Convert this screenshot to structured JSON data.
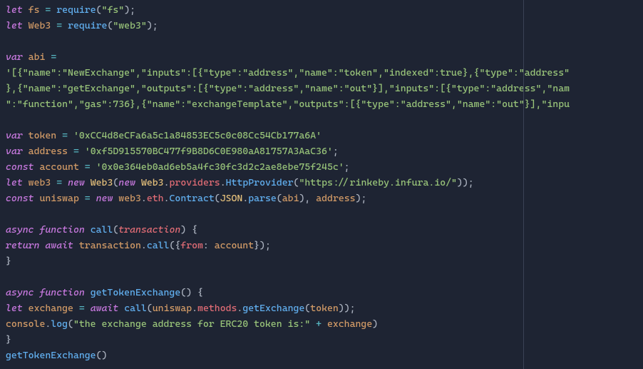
{
  "l1": {
    "kw1": "let",
    "id": "fs",
    "fn": "require",
    "str": "\"fs\""
  },
  "l2": {
    "kw1": "let",
    "id": "Web3",
    "fn": "require",
    "str": "\"web3\""
  },
  "l3": {
    "kw1": "var",
    "id": "abi",
    "op": "="
  },
  "l4": {
    "str": "'[{\"name\":\"NewExchange\",\"inputs\":[{\"type\":\"address\",\"name\":\"token\",\"indexed\":true},{\"type\":\"address\""
  },
  "l5": {
    "str": "},{\"name\":\"getExchange\",\"outputs\":[{\"type\":\"address\",\"name\":\"out\"}],\"inputs\":[{\"type\":\"address\",\"nam"
  },
  "l6": {
    "str": "\":\"function\",\"gas\":736},{\"name\":\"exchangeTemplate\",\"outputs\":[{\"type\":\"address\",\"name\":\"out\"}],\"inpu"
  },
  "l7": {
    "kw1": "var",
    "id": "token",
    "str": "'0xCC4d8eCFa6a5c1a84853EC5c0c08Cc54Cb177a6A'"
  },
  "l8": {
    "kw1": "var",
    "id": "address",
    "str": "'0xf5D915570BC477f9B8D6C0E980aA81757A3AaC36'"
  },
  "l9": {
    "kw1": "const",
    "id": "account",
    "str": "'0x0e364eb0ad6eb5a4fc30fc3d2c2ae8ebe75f245c'"
  },
  "l10": {
    "kw1": "let",
    "id": "web3",
    "kw2": "new",
    "cls1": "Web3",
    "kw3": "new",
    "cls2": "Web3",
    "prop1": "providers",
    "prop2": "HttpProvider",
    "str": "\"https://rinkeby.infura.io/\""
  },
  "l11": {
    "kw1": "const",
    "id": "uniswap",
    "kw2": "new",
    "id2": "web3",
    "prop1": "eth",
    "prop2": "Contract",
    "cls": "JSON",
    "fn": "parse",
    "arg1": "abi",
    "arg2": "address"
  },
  "l12": {
    "kw1": "async",
    "kw2": "function",
    "fn": "call",
    "param": "transaction"
  },
  "l13": {
    "kw1": "return",
    "kw2": "await",
    "id": "transaction",
    "fn": "call",
    "prop": "from",
    "id2": "account"
  },
  "l14": {
    "kw1": "async",
    "kw2": "function",
    "fn": "getTokenExchange"
  },
  "l15": {
    "kw1": "let",
    "id": "exchange",
    "kw2": "await",
    "fn1": "call",
    "id2": "uniswap",
    "prop": "methods",
    "fn2": "getExchange",
    "arg": "token"
  },
  "l16": {
    "id": "console",
    "fn": "log",
    "str": "\"the exchange address for ERC20 token is:\"",
    "op": "+",
    "id2": "exchange"
  },
  "l17": {
    "fn": "getTokenExchange"
  }
}
